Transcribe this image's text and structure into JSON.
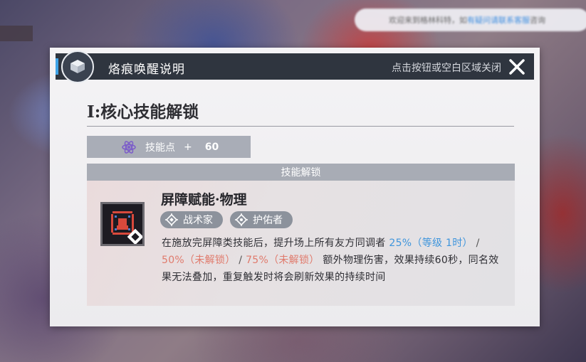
{
  "background": {
    "notice_prefix": "欢迎来到格林科特，如",
    "notice_highlight": "有疑问请联系客服",
    "notice_suffix": "咨询"
  },
  "dialog": {
    "title": "烙痕唤醒说明",
    "close_hint": "点击按钮或空白区域关闭",
    "section_title": "I:核心技能解锁",
    "points": {
      "label": "技能点",
      "plus": "+",
      "value": "60"
    },
    "unlock_header": "技能解锁",
    "skill": {
      "name": "屏障赋能·物理",
      "tags": [
        {
          "label": "战术家",
          "icon": "tactician-icon"
        },
        {
          "label": "护佑者",
          "icon": "guardian-icon"
        }
      ],
      "description": {
        "intro": "在施放完屏障类技能后，提升场上所有友方同调者",
        "level1": "25%（等级 1时）",
        "sep": " / ",
        "level2": "50%（未解锁）",
        "level3": "75%（未解锁）",
        "outro": "额外物理伤害，效果持续60秒，同名效果无法叠加，重复触发时将会刷新效果的持续时间"
      }
    }
  },
  "colors": {
    "header_bg": "#2f353f",
    "accent_blue": "#3fa3e8",
    "locked_red": "#e07a6c",
    "level_blue": "#3f95dc",
    "tag_bg": "#8c929c"
  }
}
